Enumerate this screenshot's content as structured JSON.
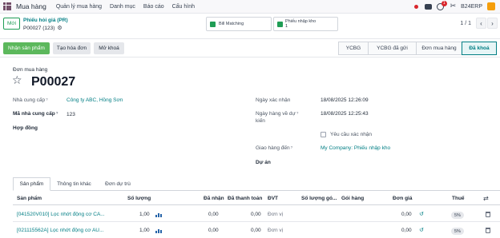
{
  "app": {
    "name": "Mua hàng"
  },
  "menu": [
    "Quản lý mua hàng",
    "Danh mục",
    "Báo cáo",
    "Cấu hình"
  ],
  "topbar": {
    "company": "B24ERP",
    "clock_badge": "1",
    "tools_glyph": "✂"
  },
  "control": {
    "new_label": "Mới",
    "breadcrumb_parent": "Phiếu hỏi giá (PR)",
    "breadcrumb_current": "P00027 (123)",
    "gear_glyph": "⚙",
    "smart_bill": "Bill Matching",
    "smart_receipt_label": "Phiếu nhập kho",
    "smart_receipt_count": "1",
    "pager": "1 / 1",
    "prev": "‹",
    "next": "›"
  },
  "actions": {
    "confirm": "Nhận sản phẩm",
    "create_bill": "Tạo hóa đơn",
    "unlock": "Mở khoá"
  },
  "status_stages": [
    "YCBG",
    "YCBG đã gửi",
    "Đơn mua hàng",
    "Đã khoá"
  ],
  "form": {
    "order_label": "Đơn mua hàng",
    "star_glyph": "☆",
    "order_number": "P00027",
    "vendor_label": "Nhà cung cấp",
    "vendor_value": "Công ty ABC, Hồng Sơn",
    "vendor_code_label": "Mã nhà cung cấp",
    "vendor_code_value": "123",
    "contract_label": "Hợp đồng",
    "confirm_date_label": "Ngày xác nhận",
    "confirm_date_value": "18/08/2025 12:26:09",
    "expected_label_1": "Ngày hàng về dự",
    "expected_label_2": "kiến",
    "expected_value": "18/08/2025 12:25:43",
    "ask_confirm_label": "Yêu cầu xác nhận",
    "deliver_to_label": "Giao hàng đến",
    "deliver_to_value": "My Company: Phiếu nhập kho",
    "project_label": "Dự án",
    "help_mark": "?"
  },
  "tabs": [
    "Sản phẩm",
    "Thông tin khác",
    "Đơn dự trù"
  ],
  "table": {
    "headers": [
      "Sản phẩm",
      "Số lượng",
      "Đã nhận",
      "Đã thanh toán",
      "ĐVT",
      "Số lượng gó...",
      "Gói hàng",
      "Đơn giá",
      "Thuế"
    ],
    "rows": [
      {
        "product": "[041520V010] Lọc nhớt động cơ CA...",
        "qty": "1,00",
        "received": "0,00",
        "billed": "0,00",
        "uom": "Đơn vị",
        "price": "0,00",
        "tax": "5%"
      },
      {
        "product": "[021115562A] Lọc nhớt động cơ AU...",
        "qty": "1,00",
        "received": "0,00",
        "billed": "0,00",
        "uom": "Đơn vị",
        "price": "0,00",
        "tax": "5%"
      }
    ],
    "optional_glyph": "⇄",
    "undo_glyph": "↺"
  },
  "colors": {
    "brand": "#714b67",
    "primary_btn": "#5cb85c",
    "link": "#017e84",
    "alert": "#d9262c"
  }
}
